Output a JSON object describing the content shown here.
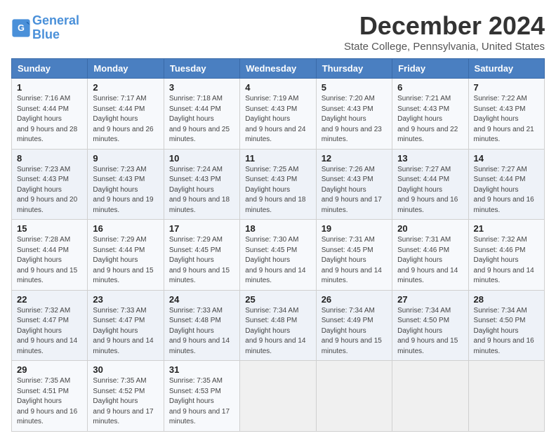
{
  "header": {
    "logo_line1": "General",
    "logo_line2": "Blue",
    "month_title": "December 2024",
    "location": "State College, Pennsylvania, United States"
  },
  "days_of_week": [
    "Sunday",
    "Monday",
    "Tuesday",
    "Wednesday",
    "Thursday",
    "Friday",
    "Saturday"
  ],
  "weeks": [
    [
      {
        "num": "1",
        "sunrise": "7:16 AM",
        "sunset": "4:44 PM",
        "daylight": "9 hours and 28 minutes."
      },
      {
        "num": "2",
        "sunrise": "7:17 AM",
        "sunset": "4:44 PM",
        "daylight": "9 hours and 26 minutes."
      },
      {
        "num": "3",
        "sunrise": "7:18 AM",
        "sunset": "4:44 PM",
        "daylight": "9 hours and 25 minutes."
      },
      {
        "num": "4",
        "sunrise": "7:19 AM",
        "sunset": "4:43 PM",
        "daylight": "9 hours and 24 minutes."
      },
      {
        "num": "5",
        "sunrise": "7:20 AM",
        "sunset": "4:43 PM",
        "daylight": "9 hours and 23 minutes."
      },
      {
        "num": "6",
        "sunrise": "7:21 AM",
        "sunset": "4:43 PM",
        "daylight": "9 hours and 22 minutes."
      },
      {
        "num": "7",
        "sunrise": "7:22 AM",
        "sunset": "4:43 PM",
        "daylight": "9 hours and 21 minutes."
      }
    ],
    [
      {
        "num": "8",
        "sunrise": "7:23 AM",
        "sunset": "4:43 PM",
        "daylight": "9 hours and 20 minutes."
      },
      {
        "num": "9",
        "sunrise": "7:23 AM",
        "sunset": "4:43 PM",
        "daylight": "9 hours and 19 minutes."
      },
      {
        "num": "10",
        "sunrise": "7:24 AM",
        "sunset": "4:43 PM",
        "daylight": "9 hours and 18 minutes."
      },
      {
        "num": "11",
        "sunrise": "7:25 AM",
        "sunset": "4:43 PM",
        "daylight": "9 hours and 18 minutes."
      },
      {
        "num": "12",
        "sunrise": "7:26 AM",
        "sunset": "4:43 PM",
        "daylight": "9 hours and 17 minutes."
      },
      {
        "num": "13",
        "sunrise": "7:27 AM",
        "sunset": "4:44 PM",
        "daylight": "9 hours and 16 minutes."
      },
      {
        "num": "14",
        "sunrise": "7:27 AM",
        "sunset": "4:44 PM",
        "daylight": "9 hours and 16 minutes."
      }
    ],
    [
      {
        "num": "15",
        "sunrise": "7:28 AM",
        "sunset": "4:44 PM",
        "daylight": "9 hours and 15 minutes."
      },
      {
        "num": "16",
        "sunrise": "7:29 AM",
        "sunset": "4:44 PM",
        "daylight": "9 hours and 15 minutes."
      },
      {
        "num": "17",
        "sunrise": "7:29 AM",
        "sunset": "4:45 PM",
        "daylight": "9 hours and 15 minutes."
      },
      {
        "num": "18",
        "sunrise": "7:30 AM",
        "sunset": "4:45 PM",
        "daylight": "9 hours and 14 minutes."
      },
      {
        "num": "19",
        "sunrise": "7:31 AM",
        "sunset": "4:45 PM",
        "daylight": "9 hours and 14 minutes."
      },
      {
        "num": "20",
        "sunrise": "7:31 AM",
        "sunset": "4:46 PM",
        "daylight": "9 hours and 14 minutes."
      },
      {
        "num": "21",
        "sunrise": "7:32 AM",
        "sunset": "4:46 PM",
        "daylight": "9 hours and 14 minutes."
      }
    ],
    [
      {
        "num": "22",
        "sunrise": "7:32 AM",
        "sunset": "4:47 PM",
        "daylight": "9 hours and 14 minutes."
      },
      {
        "num": "23",
        "sunrise": "7:33 AM",
        "sunset": "4:47 PM",
        "daylight": "9 hours and 14 minutes."
      },
      {
        "num": "24",
        "sunrise": "7:33 AM",
        "sunset": "4:48 PM",
        "daylight": "9 hours and 14 minutes."
      },
      {
        "num": "25",
        "sunrise": "7:34 AM",
        "sunset": "4:48 PM",
        "daylight": "9 hours and 14 minutes."
      },
      {
        "num": "26",
        "sunrise": "7:34 AM",
        "sunset": "4:49 PM",
        "daylight": "9 hours and 15 minutes."
      },
      {
        "num": "27",
        "sunrise": "7:34 AM",
        "sunset": "4:50 PM",
        "daylight": "9 hours and 15 minutes."
      },
      {
        "num": "28",
        "sunrise": "7:34 AM",
        "sunset": "4:50 PM",
        "daylight": "9 hours and 16 minutes."
      }
    ],
    [
      {
        "num": "29",
        "sunrise": "7:35 AM",
        "sunset": "4:51 PM",
        "daylight": "9 hours and 16 minutes."
      },
      {
        "num": "30",
        "sunrise": "7:35 AM",
        "sunset": "4:52 PM",
        "daylight": "9 hours and 17 minutes."
      },
      {
        "num": "31",
        "sunrise": "7:35 AM",
        "sunset": "4:53 PM",
        "daylight": "9 hours and 17 minutes."
      },
      null,
      null,
      null,
      null
    ]
  ]
}
